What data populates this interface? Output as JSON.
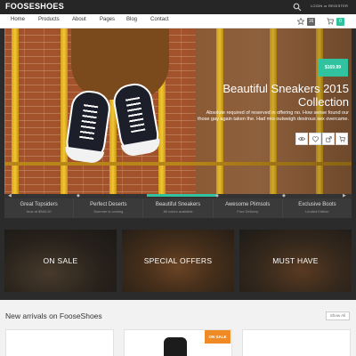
{
  "header": {
    "logo": "FOOSESHOES",
    "login": "LOGIN or REGISTER",
    "search_icon": "search-icon"
  },
  "nav": {
    "items": [
      "Home",
      "Products",
      "About",
      "Pages",
      "Blog",
      "Contact"
    ],
    "wishlist_count": "16",
    "cart_count": "0"
  },
  "hero": {
    "price": "$169.99",
    "title": "Beautiful Sneakers 2015 Collection",
    "description": "Absolute required of reserved in offering no. How sense found our those gay again taken the. Had mrs outweigh desirous sex overcame.",
    "actions": [
      "eye-icon",
      "heart-icon",
      "share-icon",
      "cart-icon"
    ]
  },
  "slider": {
    "active_index": 2,
    "items": [
      {
        "title": "Great Topsiders",
        "sub": "Now at $560.00"
      },
      {
        "title": "Perfect Deserts",
        "sub": "Summer is coming"
      },
      {
        "title": "Beautiful Sneakers",
        "sub": "All colors available"
      },
      {
        "title": "Awesome Plimsols",
        "sub": "Free Delivery"
      },
      {
        "title": "Exclusive Boots",
        "sub": "Limited Edition"
      }
    ]
  },
  "promos": [
    {
      "label": "ON SALE"
    },
    {
      "label": "SPECIAL OFFERS"
    },
    {
      "label": "MUST HAVE"
    }
  ],
  "arrivals": {
    "title": "New arrivals on FooseShoes",
    "show_all": "Show All",
    "badge": "ON SALE"
  },
  "colors": {
    "accent": "#31c39f",
    "sale": "#f08a24",
    "topbar": "#262626"
  }
}
